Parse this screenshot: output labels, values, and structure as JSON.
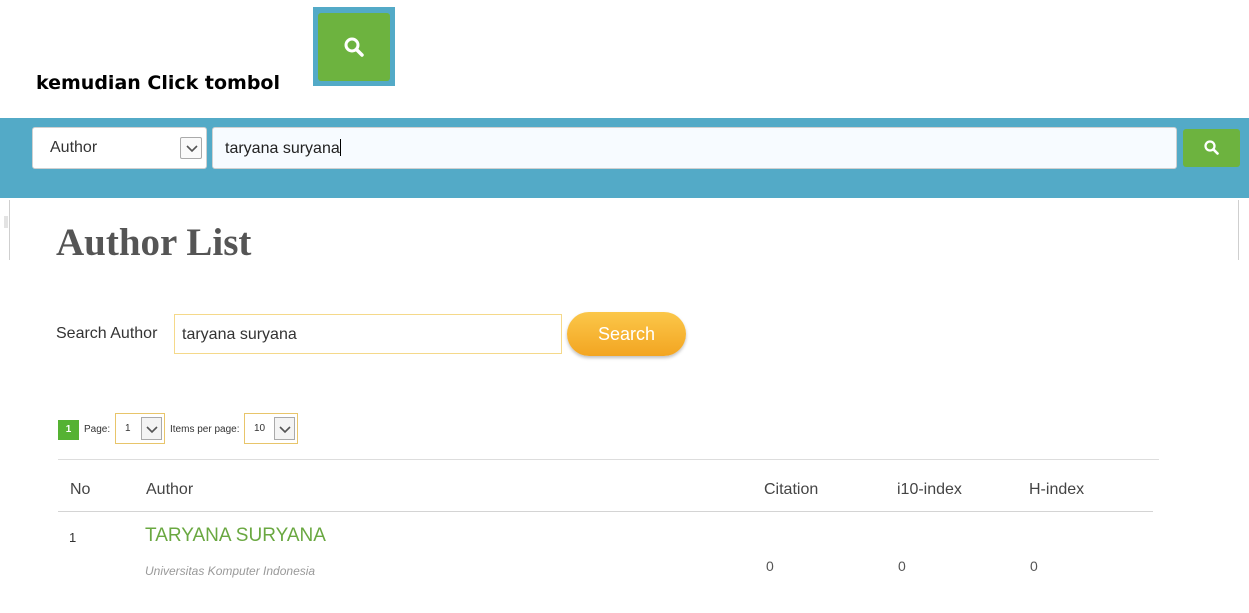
{
  "instruction": {
    "text": "kemudian Click tombol"
  },
  "topbar": {
    "field_select": "Author",
    "query": "taryana suryana"
  },
  "page": {
    "title": "Author List"
  },
  "search_form": {
    "label": "Search Author",
    "value": "taryana suryana",
    "button": "Search"
  },
  "pagination": {
    "current": "1",
    "page_label": "Page:",
    "page_value": "1",
    "per_page_label": "Items per page:",
    "per_page_value": "10"
  },
  "table": {
    "headers": {
      "no": "No",
      "author": "Author",
      "citation": "Citation",
      "i10": "i10-index",
      "h": "H-index"
    },
    "rows": [
      {
        "no": "1",
        "name": "TARYANA SURYANA",
        "affiliation": "Universitas Komputer Indonesia",
        "citation": "0",
        "i10": "0",
        "h": "0"
      }
    ]
  },
  "colors": {
    "bar": "#53aac7",
    "green": "#6db33f",
    "orange": "#f3a521"
  }
}
